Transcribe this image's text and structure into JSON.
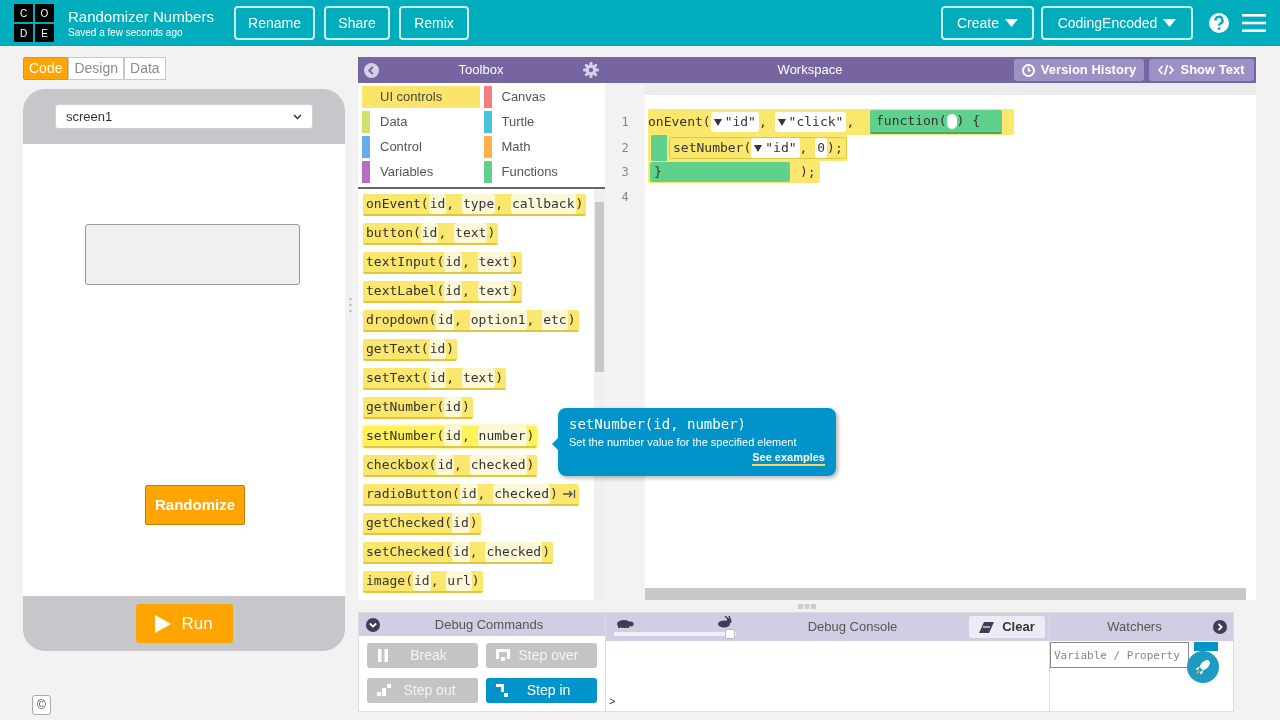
{
  "app_bar": {
    "logo_letters": [
      "C",
      "O",
      "D",
      "E"
    ],
    "project_title": "Randomizer Numbers",
    "save_status": "Saved a few seconds ago",
    "buttons": [
      {
        "label": "Rename"
      },
      {
        "label": "Share"
      },
      {
        "label": "Remix"
      }
    ],
    "menus": [
      {
        "label": "Create"
      },
      {
        "label": "CodingEncoded"
      }
    ]
  },
  "mode_tabs": [
    {
      "label": "Code",
      "selected": true
    },
    {
      "label": "Design",
      "selected": false
    },
    {
      "label": "Data",
      "selected": false
    }
  ],
  "screen_select": {
    "value": "screen1"
  },
  "app_preview": {
    "button": {
      "label": "Randomize"
    }
  },
  "run_button": {
    "label": "Run"
  },
  "toolbox": {
    "title": "Toolbox",
    "categories": [
      {
        "label": "UI controls",
        "color": "#fbe46a",
        "selected": true
      },
      {
        "label": "Canvas",
        "color": "#f47b7e",
        "selected": false
      },
      {
        "label": "Data",
        "color": "#cfe26a",
        "selected": false
      },
      {
        "label": "Turtle",
        "color": "#45c6dc",
        "selected": false
      },
      {
        "label": "Control",
        "color": "#64aef0",
        "selected": false
      },
      {
        "label": "Math",
        "color": "#ffae48",
        "selected": false
      },
      {
        "label": "Variables",
        "color": "#b46ec6",
        "selected": false
      },
      {
        "label": "Functions",
        "color": "#5fd18c",
        "selected": false
      }
    ],
    "blocks": [
      {
        "parts": [
          "onEvent(",
          "id",
          ", ",
          "type",
          ", ",
          "callback",
          ")"
        ]
      },
      {
        "parts": [
          "button(",
          "id",
          ", ",
          "text",
          ")"
        ]
      },
      {
        "parts": [
          "textInput(",
          "id",
          ", ",
          "text",
          ")"
        ]
      },
      {
        "parts": [
          "textLabel(",
          "id",
          ", ",
          "text",
          ")"
        ]
      },
      {
        "parts": [
          "dropdown(",
          "id",
          ", ",
          "option1",
          ", ",
          "etc",
          ")"
        ]
      },
      {
        "parts": [
          "getText(",
          "id",
          ")"
        ]
      },
      {
        "parts": [
          "setText(",
          "id",
          ", ",
          "text",
          ")"
        ]
      },
      {
        "parts": [
          "getNumber(",
          "id",
          ")"
        ]
      },
      {
        "parts": [
          "setNumber(",
          "id",
          ", ",
          "number",
          ")"
        ],
        "hovered": true
      },
      {
        "parts": [
          "checkbox(",
          "id",
          ", ",
          "checked",
          ")"
        ]
      },
      {
        "parts": [
          "radioButton(",
          "id",
          ", ",
          "checked",
          ")"
        ],
        "arrow": true
      },
      {
        "parts": [
          "getChecked(",
          "id",
          ")"
        ]
      },
      {
        "parts": [
          "setChecked(",
          "id",
          ", ",
          "checked",
          ")"
        ]
      },
      {
        "parts": [
          "image(",
          "id",
          ", ",
          "url",
          ")"
        ]
      }
    ]
  },
  "tooltip": {
    "signature": "setNumber(id, number)",
    "description": "Set the number value for the specified element",
    "link": "See examples"
  },
  "workspace": {
    "title": "Workspace",
    "buttons": [
      {
        "label": "Version History",
        "kind": "history"
      },
      {
        "label": "Show Text",
        "kind": "code"
      }
    ],
    "lines": [
      {
        "number": "1",
        "kind": "open",
        "tokens": [
          {
            "kind": "text",
            "text": "onEvent("
          },
          {
            "kind": "dropdown",
            "text": "\"id\""
          },
          {
            "kind": "text",
            "text": ", "
          },
          {
            "kind": "dropdown",
            "text": "\"click\""
          },
          {
            "kind": "text",
            "text": ", "
          },
          {
            "kind": "function",
            "before": "function(",
            "after": ") {"
          }
        ]
      },
      {
        "number": "2",
        "kind": "inner",
        "tokens": [
          {
            "kind": "text",
            "text": "setNumber("
          },
          {
            "kind": "dropdown",
            "text": "\"id\""
          },
          {
            "kind": "text",
            "text": ", "
          },
          {
            "kind": "value",
            "text": "0"
          },
          {
            "kind": "text",
            "text": ");"
          }
        ]
      },
      {
        "number": "3",
        "kind": "close",
        "tokens": [
          {
            "kind": "function_end",
            "text": "}"
          },
          {
            "kind": "text",
            "text": ");"
          }
        ]
      },
      {
        "number": "4",
        "kind": "empty"
      }
    ]
  },
  "debug_commands": {
    "title": "Debug Commands",
    "buttons": [
      {
        "label": "Break",
        "kind": "pause",
        "disabled": true
      },
      {
        "label": "Step over",
        "kind": "over",
        "disabled": true
      },
      {
        "label": "Step out",
        "kind": "out",
        "disabled": true
      },
      {
        "label": "Step in",
        "kind": "in",
        "disabled": false
      }
    ]
  },
  "debug_console": {
    "title": "Debug Console",
    "speed": {
      "level": 0.95
    },
    "clear_label": "Clear",
    "prompt": ">"
  },
  "watchers": {
    "title": "Watchers",
    "placeholder": "Variable / Property"
  },
  "footer": {
    "copyright": "©"
  }
}
